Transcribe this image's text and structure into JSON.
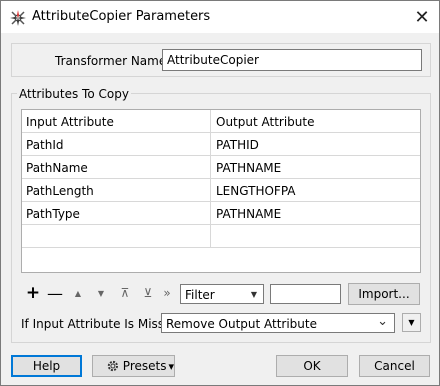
{
  "window": {
    "title": "AttributeCopier Parameters",
    "close_glyph": "✕"
  },
  "transformer": {
    "label": "Transformer Name:",
    "value": "AttributeCopier"
  },
  "group": {
    "label": "Attributes To Copy",
    "columns": [
      "Input Attribute",
      "Output Attribute"
    ],
    "rows": [
      {
        "input": "PathId",
        "output": "PATHID"
      },
      {
        "input": "PathName",
        "output": "PATHNAME"
      },
      {
        "input": "PathLength",
        "output": "LENGTHOFPA"
      },
      {
        "input": "PathType",
        "output": "PATHNAME"
      },
      {
        "input": "",
        "output": ""
      }
    ]
  },
  "toolbar": {
    "add": "+",
    "remove": "—",
    "move_up": "▲",
    "move_down": "▼",
    "move_top": "⊼",
    "move_bottom": "⊻",
    "more": "»",
    "filter_value": "Filter",
    "filter_arrow": "▼",
    "search_value": "",
    "import_label": "Import..."
  },
  "missing": {
    "label": "If Input Attribute Is Missing:",
    "value": "Remove Output Attribute",
    "arrow": "⌄",
    "menu_arrow": "▼"
  },
  "buttons": {
    "help": "Help",
    "presets": "Presets",
    "presets_arrow": "▾",
    "ok": "OK",
    "cancel": "Cancel"
  },
  "colors": {
    "default_button_border": "#0078d7",
    "button_face": "#e1e1e1"
  }
}
